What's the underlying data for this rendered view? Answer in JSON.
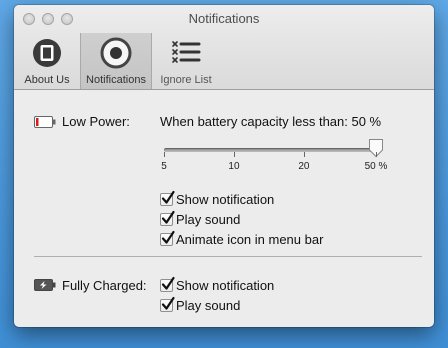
{
  "window": {
    "title": "Notifications"
  },
  "toolbar": {
    "about_label": "About Us",
    "notifications_label": "Notifications",
    "ignore_label": "Ignore List"
  },
  "low_power": {
    "label": "Low Power:",
    "capacity_prompt": "When battery capacity less than: 50 %",
    "slider": {
      "value": 50,
      "min": 5,
      "max": 50,
      "ticks": [
        "5",
        "10",
        "20",
        "50 %"
      ]
    },
    "options": [
      {
        "label": "Show notification",
        "checked": true
      },
      {
        "label": "Play sound",
        "checked": true
      },
      {
        "label": "Animate icon in menu bar",
        "checked": true
      }
    ]
  },
  "fully_charged": {
    "label": "Fully Charged:",
    "options": [
      {
        "label": "Show notification",
        "checked": true
      },
      {
        "label": "Play sound",
        "checked": true
      }
    ]
  },
  "colors": {
    "background": "#4a98dc",
    "battery_low": "#d21f1f",
    "window": "#ececec"
  }
}
